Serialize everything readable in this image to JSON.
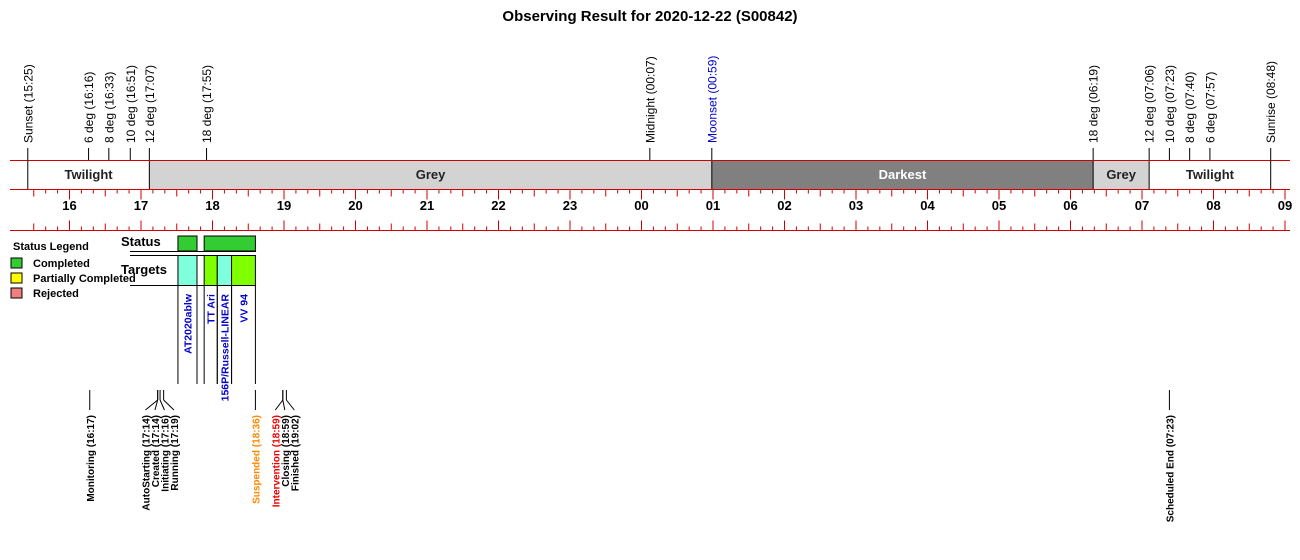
{
  "title": "Observing Result for 2020-12-22 (S00842)",
  "colors": {
    "axis_line": "#d00000",
    "twilight": "#ffffff",
    "grey": "#d3d3d3",
    "darkest": "#808080",
    "completed": "#33cc33",
    "partial": "#ffff00",
    "rejected": "#f08080",
    "target_cyan": "#80ffdd",
    "target_green": "#80ff00",
    "moon_text": "#0000cc",
    "target_text": "#0000cc",
    "suspended_text": "#ff8800",
    "intervention_text": "#ee0000",
    "default_text": "#000000"
  },
  "chart_data": {
    "type": "timeline",
    "time_axis": {
      "unit": "hours",
      "start": "15:25",
      "end": "09:00",
      "hour_labels": [
        "16",
        "17",
        "18",
        "19",
        "20",
        "21",
        "22",
        "23",
        "00",
        "01",
        "02",
        "03",
        "04",
        "05",
        "06",
        "07",
        "08",
        "09"
      ]
    },
    "sky_events": [
      {
        "label": "Sunset (15:25)",
        "time": "15:25"
      },
      {
        "label": "6 deg (16:16)",
        "time": "16:16"
      },
      {
        "label": "8 deg (16:33)",
        "time": "16:33"
      },
      {
        "label": "10 deg (16:51)",
        "time": "16:51"
      },
      {
        "label": "12 deg (17:07)",
        "time": "17:07"
      },
      {
        "label": "18 deg (17:55)",
        "time": "17:55"
      },
      {
        "label": "Midnight (00:07)",
        "time": "00:07"
      },
      {
        "label": "Moonset (00:59)",
        "time": "00:59",
        "color": "moon_text"
      },
      {
        "label": "18 deg (06:19)",
        "time": "06:19"
      },
      {
        "label": "12 deg (07:06)",
        "time": "07:06"
      },
      {
        "label": "10 deg (07:23)",
        "time": "07:23"
      },
      {
        "label": "8 deg (07:40)",
        "time": "07:40"
      },
      {
        "label": "6 deg (07:57)",
        "time": "07:57"
      },
      {
        "label": "Sunrise (08:48)",
        "time": "08:48"
      }
    ],
    "sky_bands": [
      {
        "label": "Twilight",
        "start": "15:25",
        "end": "17:07",
        "color": "twilight"
      },
      {
        "label": "Grey",
        "start": "17:07",
        "end": "00:59",
        "color": "grey"
      },
      {
        "label": "Darkest",
        "start": "00:59",
        "end": "06:19",
        "color": "darkest"
      },
      {
        "label": "Grey",
        "start": "06:19",
        "end": "07:06",
        "color": "grey"
      },
      {
        "label": "Twilight",
        "start": "07:06",
        "end": "08:48",
        "color": "twilight"
      }
    ],
    "status_label": "Status",
    "targets_label": "Targets",
    "status_blocks": [
      {
        "start": "17:31",
        "end": "17:47",
        "status": "Completed"
      },
      {
        "start": "17:53",
        "end": "18:36",
        "status": "Completed"
      }
    ],
    "targets": [
      {
        "name": "AT2020ablw",
        "start": "17:31",
        "end": "17:47",
        "color": "target_cyan"
      },
      {
        "name": "TT Ari",
        "start": "17:53",
        "end": "18:04",
        "color": "target_green"
      },
      {
        "name": "156P/Russell-LINEAR",
        "start": "18:04",
        "end": "18:16",
        "color": "target_cyan"
      },
      {
        "name": "VV 94",
        "start": "18:16",
        "end": "18:36",
        "color": "target_green"
      }
    ],
    "legend": {
      "title": "Status Legend",
      "items": [
        {
          "label": "Completed",
          "color": "completed"
        },
        {
          "label": "Partially Completed",
          "color": "partial"
        },
        {
          "label": "Rejected",
          "color": "rejected"
        }
      ]
    },
    "operation_events": [
      {
        "label": "Monitoring (16:17)",
        "time": "16:17",
        "color": "default_text"
      },
      {
        "label": "AutoStarting (17:14)",
        "time": "17:14",
        "color": "default_text"
      },
      {
        "label": "Created (17:14)",
        "time": "17:14",
        "color": "default_text"
      },
      {
        "label": "Initiating (17:16)",
        "time": "17:16",
        "color": "default_text"
      },
      {
        "label": "Running (17:19)",
        "time": "17:19",
        "color": "default_text"
      },
      {
        "label": "Suspended (18:36)",
        "time": "18:36",
        "color": "suspended_text"
      },
      {
        "label": "Intervention (18:59)",
        "time": "18:59",
        "color": "intervention_text"
      },
      {
        "label": "Closing (18:59)",
        "time": "18:59",
        "color": "default_text"
      },
      {
        "label": "Finished (19:02)",
        "time": "19:02",
        "color": "default_text"
      },
      {
        "label": "Scheduled End (07:23)",
        "time": "07:23",
        "color": "default_text"
      }
    ]
  }
}
